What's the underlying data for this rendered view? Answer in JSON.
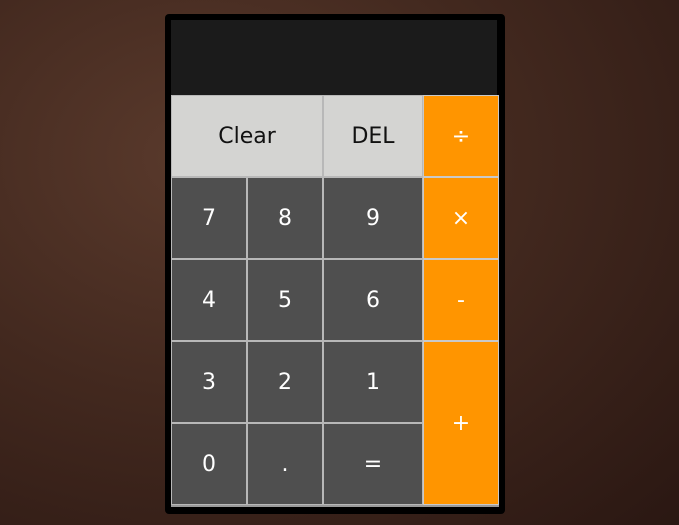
{
  "display": {
    "value": ""
  },
  "keys": {
    "clear": "Clear",
    "del": "DEL",
    "divide": "÷",
    "seven": "7",
    "eight": "8",
    "nine": "9",
    "multiply": "×",
    "four": "4",
    "five": "5",
    "six": "6",
    "minus": "-",
    "three": "3",
    "two": "2",
    "one": "1",
    "plus": "+",
    "zero": "0",
    "dot": ".",
    "equals": "="
  },
  "colors": {
    "operator": "#ff9500",
    "function": "#d4d4d2",
    "number": "#4f4f4f",
    "display": "#1b1b1b"
  }
}
